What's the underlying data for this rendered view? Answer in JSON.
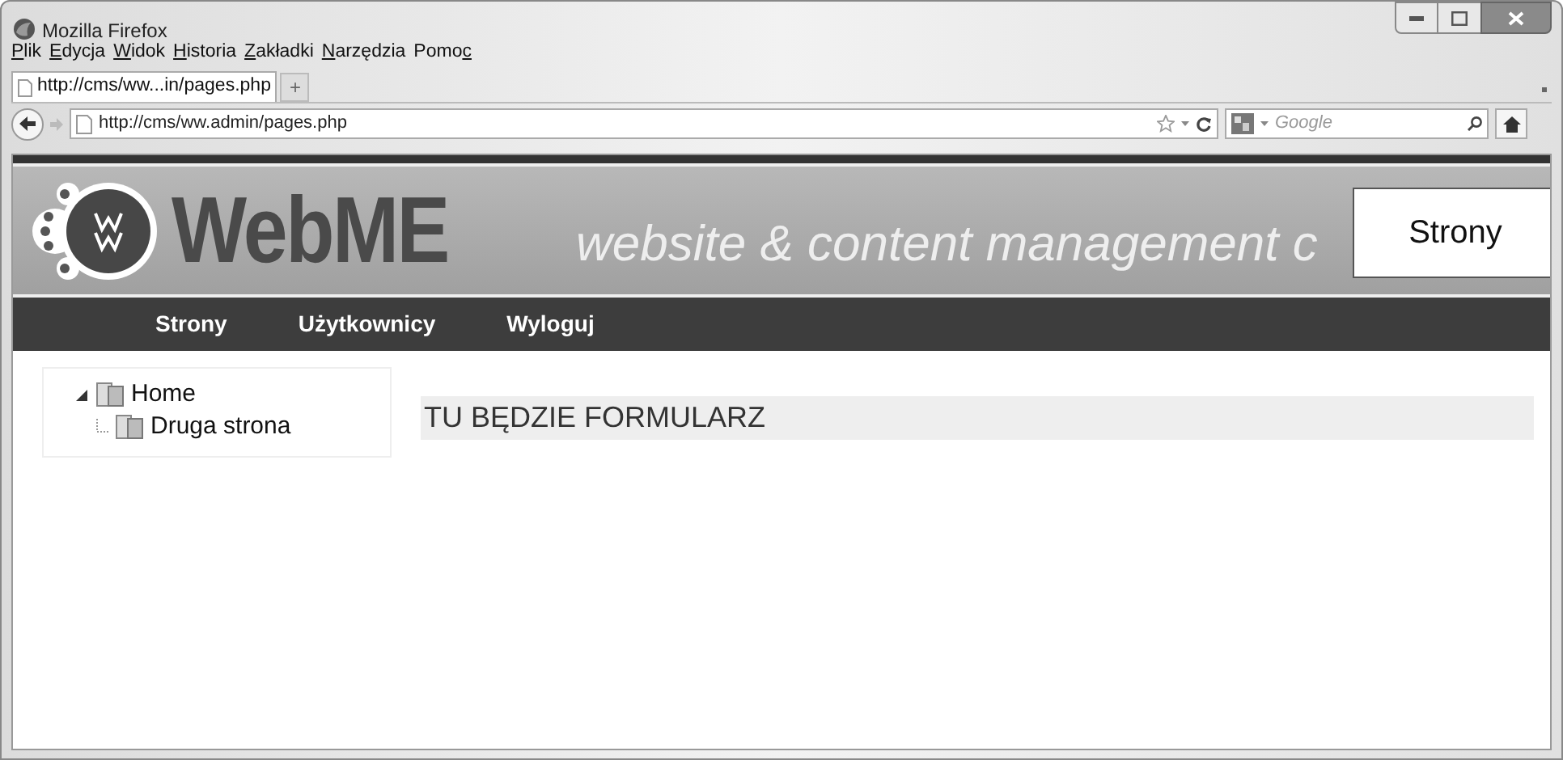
{
  "window": {
    "title": "Mozilla Firefox"
  },
  "menu": [
    {
      "key": "P",
      "after": "lik"
    },
    {
      "key": "E",
      "after": "dycja"
    },
    {
      "key": "W",
      "after": "idok"
    },
    {
      "key": "H",
      "after": "istoria"
    },
    {
      "key": "Z",
      "after": "akładki"
    },
    {
      "key": "N",
      "after": "arzędzia"
    },
    {
      "before": "Pomo",
      "key": "c"
    }
  ],
  "tabs": [
    {
      "label": "http://cms/ww...in/pages.php",
      "selected": true
    }
  ],
  "new_tab": "+",
  "address": "http://cms/ww.admin/pages.php",
  "search": {
    "placeholder": "Google"
  },
  "site": {
    "logo": "WebME",
    "tagline": "website & content management c",
    "page_badge": "Strony",
    "nav": [
      "Strony",
      "Użytkownicy",
      "Wyloguj"
    ],
    "tree": [
      {
        "label": "Home",
        "expanded": true,
        "children": [
          {
            "label": "Druga strona"
          }
        ]
      }
    ],
    "content_heading": "TU BĘDZIE FORMULARZ"
  }
}
